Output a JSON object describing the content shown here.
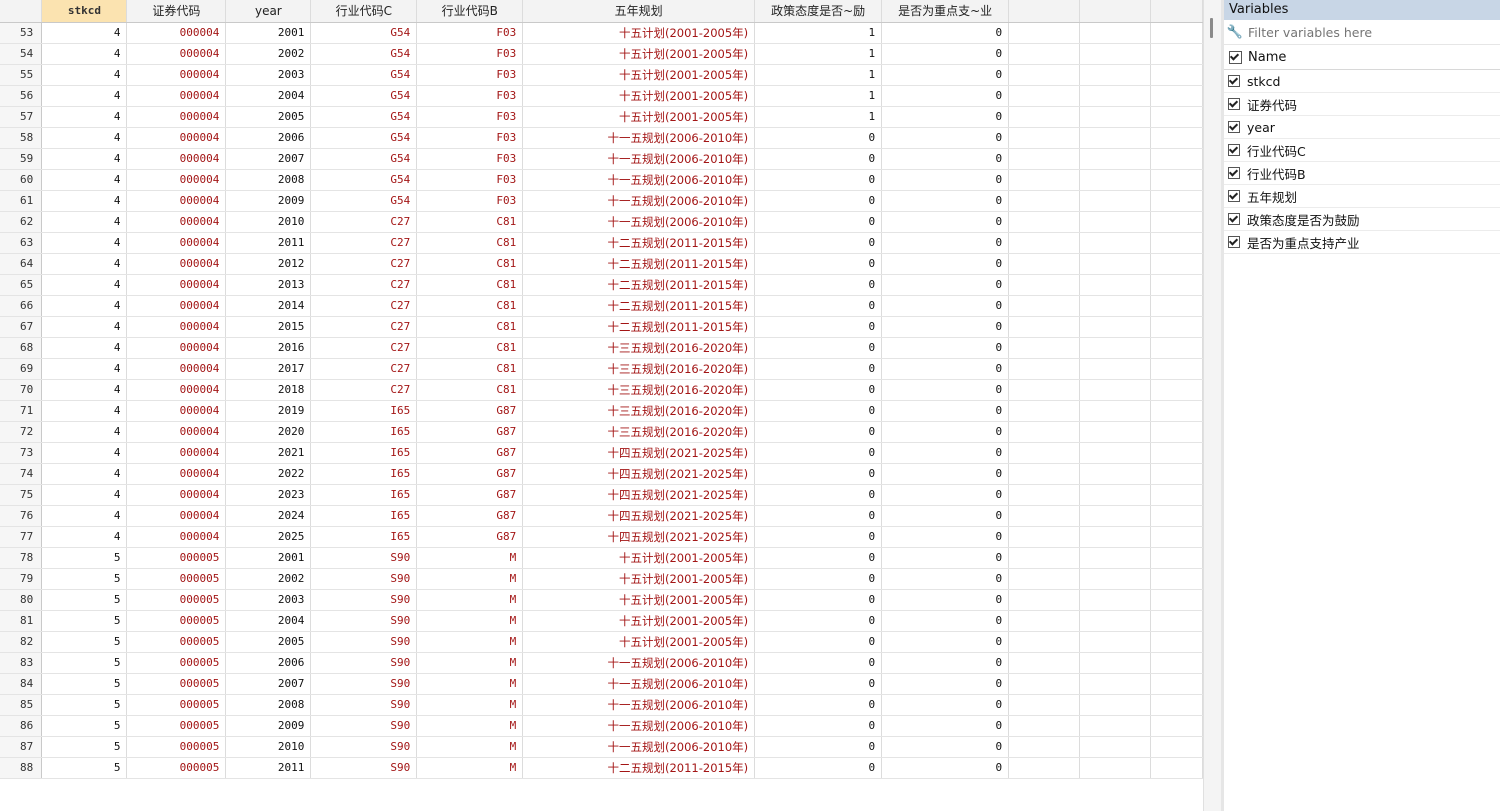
{
  "columns": [
    "stkcd",
    "证券代码",
    "year",
    "行业代码C",
    "行业代码B",
    "五年规划",
    "政策态度是否~励",
    "是否为重点支~业"
  ],
  "rows": [
    [
      "53",
      "4",
      "000004",
      "2001",
      "G54",
      "F03",
      "十五计划(2001-2005年)",
      "1",
      "0"
    ],
    [
      "54",
      "4",
      "000004",
      "2002",
      "G54",
      "F03",
      "十五计划(2001-2005年)",
      "1",
      "0"
    ],
    [
      "55",
      "4",
      "000004",
      "2003",
      "G54",
      "F03",
      "十五计划(2001-2005年)",
      "1",
      "0"
    ],
    [
      "56",
      "4",
      "000004",
      "2004",
      "G54",
      "F03",
      "十五计划(2001-2005年)",
      "1",
      "0"
    ],
    [
      "57",
      "4",
      "000004",
      "2005",
      "G54",
      "F03",
      "十五计划(2001-2005年)",
      "1",
      "0"
    ],
    [
      "58",
      "4",
      "000004",
      "2006",
      "G54",
      "F03",
      "十一五规划(2006-2010年)",
      "0",
      "0"
    ],
    [
      "59",
      "4",
      "000004",
      "2007",
      "G54",
      "F03",
      "十一五规划(2006-2010年)",
      "0",
      "0"
    ],
    [
      "60",
      "4",
      "000004",
      "2008",
      "G54",
      "F03",
      "十一五规划(2006-2010年)",
      "0",
      "0"
    ],
    [
      "61",
      "4",
      "000004",
      "2009",
      "G54",
      "F03",
      "十一五规划(2006-2010年)",
      "0",
      "0"
    ],
    [
      "62",
      "4",
      "000004",
      "2010",
      "C27",
      "C81",
      "十一五规划(2006-2010年)",
      "0",
      "0"
    ],
    [
      "63",
      "4",
      "000004",
      "2011",
      "C27",
      "C81",
      "十二五规划(2011-2015年)",
      "0",
      "0"
    ],
    [
      "64",
      "4",
      "000004",
      "2012",
      "C27",
      "C81",
      "十二五规划(2011-2015年)",
      "0",
      "0"
    ],
    [
      "65",
      "4",
      "000004",
      "2013",
      "C27",
      "C81",
      "十二五规划(2011-2015年)",
      "0",
      "0"
    ],
    [
      "66",
      "4",
      "000004",
      "2014",
      "C27",
      "C81",
      "十二五规划(2011-2015年)",
      "0",
      "0"
    ],
    [
      "67",
      "4",
      "000004",
      "2015",
      "C27",
      "C81",
      "十二五规划(2011-2015年)",
      "0",
      "0"
    ],
    [
      "68",
      "4",
      "000004",
      "2016",
      "C27",
      "C81",
      "十三五规划(2016-2020年)",
      "0",
      "0"
    ],
    [
      "69",
      "4",
      "000004",
      "2017",
      "C27",
      "C81",
      "十三五规划(2016-2020年)",
      "0",
      "0"
    ],
    [
      "70",
      "4",
      "000004",
      "2018",
      "C27",
      "C81",
      "十三五规划(2016-2020年)",
      "0",
      "0"
    ],
    [
      "71",
      "4",
      "000004",
      "2019",
      "I65",
      "G87",
      "十三五规划(2016-2020年)",
      "0",
      "0"
    ],
    [
      "72",
      "4",
      "000004",
      "2020",
      "I65",
      "G87",
      "十三五规划(2016-2020年)",
      "0",
      "0"
    ],
    [
      "73",
      "4",
      "000004",
      "2021",
      "I65",
      "G87",
      "十四五规划(2021-2025年)",
      "0",
      "0"
    ],
    [
      "74",
      "4",
      "000004",
      "2022",
      "I65",
      "G87",
      "十四五规划(2021-2025年)",
      "0",
      "0"
    ],
    [
      "75",
      "4",
      "000004",
      "2023",
      "I65",
      "G87",
      "十四五规划(2021-2025年)",
      "0",
      "0"
    ],
    [
      "76",
      "4",
      "000004",
      "2024",
      "I65",
      "G87",
      "十四五规划(2021-2025年)",
      "0",
      "0"
    ],
    [
      "77",
      "4",
      "000004",
      "2025",
      "I65",
      "G87",
      "十四五规划(2021-2025年)",
      "0",
      "0"
    ],
    [
      "78",
      "5",
      "000005",
      "2001",
      "S90",
      "M",
      "十五计划(2001-2005年)",
      "0",
      "0"
    ],
    [
      "79",
      "5",
      "000005",
      "2002",
      "S90",
      "M",
      "十五计划(2001-2005年)",
      "0",
      "0"
    ],
    [
      "80",
      "5",
      "000005",
      "2003",
      "S90",
      "M",
      "十五计划(2001-2005年)",
      "0",
      "0"
    ],
    [
      "81",
      "5",
      "000005",
      "2004",
      "S90",
      "M",
      "十五计划(2001-2005年)",
      "0",
      "0"
    ],
    [
      "82",
      "5",
      "000005",
      "2005",
      "S90",
      "M",
      "十五计划(2001-2005年)",
      "0",
      "0"
    ],
    [
      "83",
      "5",
      "000005",
      "2006",
      "S90",
      "M",
      "十一五规划(2006-2010年)",
      "0",
      "0"
    ],
    [
      "84",
      "5",
      "000005",
      "2007",
      "S90",
      "M",
      "十一五规划(2006-2010年)",
      "0",
      "0"
    ],
    [
      "85",
      "5",
      "000005",
      "2008",
      "S90",
      "M",
      "十一五规划(2006-2010年)",
      "0",
      "0"
    ],
    [
      "86",
      "5",
      "000005",
      "2009",
      "S90",
      "M",
      "十一五规划(2006-2010年)",
      "0",
      "0"
    ],
    [
      "87",
      "5",
      "000005",
      "2010",
      "S90",
      "M",
      "十一五规划(2006-2010年)",
      "0",
      "0"
    ],
    [
      "88",
      "5",
      "000005",
      "2011",
      "S90",
      "M",
      "十二五规划(2011-2015年)",
      "0",
      "0"
    ]
  ],
  "variables_panel": {
    "title": "Variables",
    "filter_placeholder": "Filter variables here",
    "name_header": "Name",
    "items": [
      "stkcd",
      "证券代码",
      "year",
      "行业代码C",
      "行业代码B",
      "五年规划",
      "政策态度是否为鼓励",
      "是否为重点支持产业"
    ]
  },
  "colors": {
    "selected_header": "#fbe3b0",
    "string_text": "#a31515",
    "panel_title_bg": "#c8d6e6"
  }
}
